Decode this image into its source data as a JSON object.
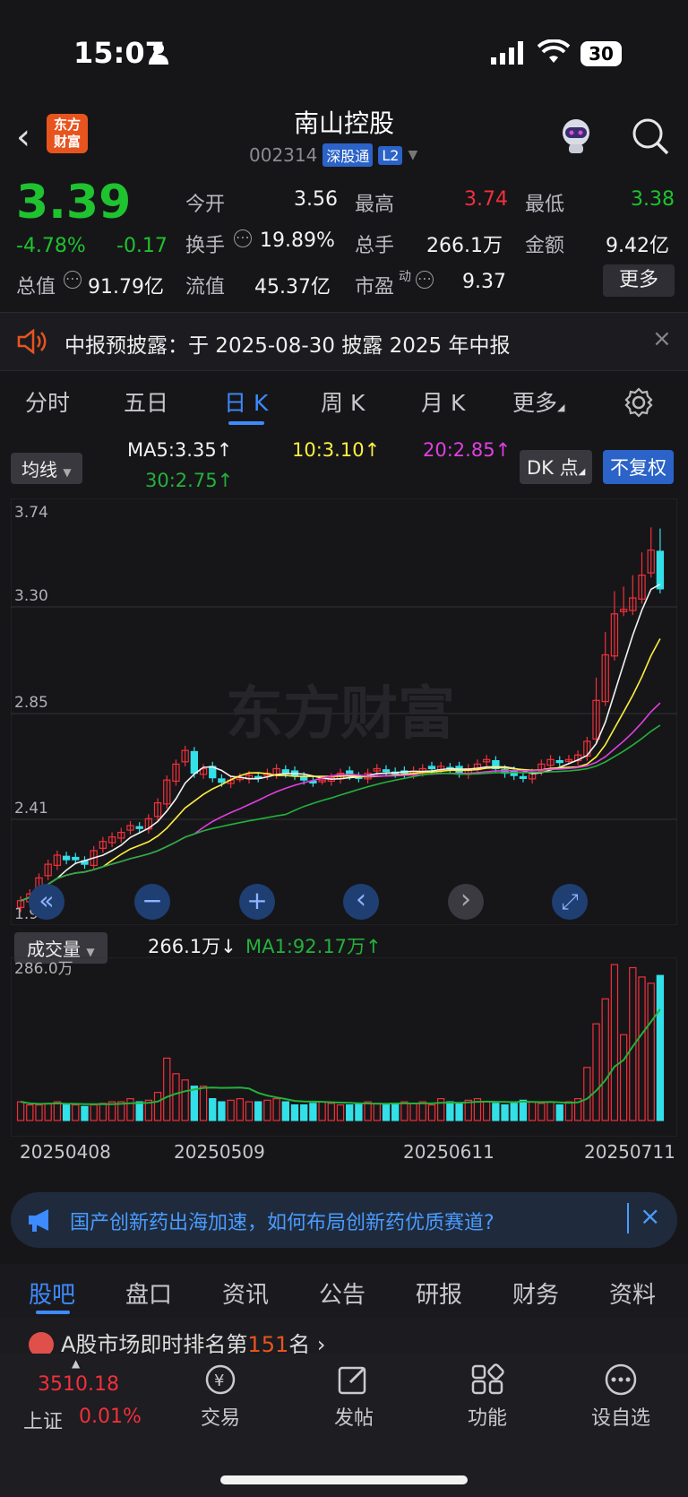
{
  "status": {
    "time": "15:07",
    "battery": "30"
  },
  "header": {
    "logo_line1": "东方",
    "logo_line2": "财富",
    "name": "南山控股",
    "code": "002314",
    "badge1": "深股通",
    "badge2": "L2"
  },
  "quote": {
    "price": "3.39",
    "change_pct": "-4.78%",
    "change": "-0.17",
    "open_label": "今开",
    "open": "3.56",
    "high_label": "最高",
    "high": "3.74",
    "low_label": "最低",
    "low": "3.38",
    "turnover_label": "换手",
    "turnover": "19.89%",
    "volume_label": "总手",
    "volume": "266.1万",
    "amount_label": "金额",
    "amount": "9.42亿",
    "mcap_label": "总值",
    "mcap": "91.79亿",
    "float_label": "流值",
    "float": "45.37亿",
    "pe_label": "市盈",
    "pe_sup": "动",
    "pe": "9.37",
    "more": "更多"
  },
  "notice": {
    "text": "中报预披露：于 2025-08-30 披露 2025 年中报"
  },
  "tabs": [
    "分时",
    "五日",
    "日 K",
    "周 K",
    "月 K",
    "更多"
  ],
  "ma": {
    "selector": "均线",
    "ma5": "MA5:3.35",
    "ma10": "10:3.10",
    "ma20": "20:2.85",
    "ma30": "30:2.75",
    "dk": "DK 点",
    "fq": "不复权"
  },
  "kchart": {
    "watermark": "东方财富",
    "y_labels": [
      "3.74",
      "3.30",
      "2.85",
      "2.41",
      "1.96"
    ]
  },
  "volume": {
    "selector": "成交量",
    "value": "266.1万",
    "ma1": "MA1:92.17万",
    "max_label": "286.0万"
  },
  "chart_data": {
    "type": "candlestick",
    "y_range": [
      1.96,
      3.74
    ],
    "x_labels": [
      "20250408",
      "20250509",
      "20250611",
      "20250711"
    ],
    "volume_max": "286.0万",
    "close": [
      2.02,
      2.05,
      2.12,
      2.18,
      2.22,
      2.2,
      2.2,
      2.18,
      2.24,
      2.28,
      2.3,
      2.32,
      2.35,
      2.34,
      2.38,
      2.45,
      2.55,
      2.62,
      2.68,
      2.58,
      2.6,
      2.56,
      2.54,
      2.55,
      2.56,
      2.57,
      2.56,
      2.58,
      2.6,
      2.58,
      2.57,
      2.55,
      2.54,
      2.55,
      2.56,
      2.58,
      2.57,
      2.56,
      2.58,
      2.6,
      2.59,
      2.58,
      2.58,
      2.59,
      2.6,
      2.6,
      2.61,
      2.6,
      2.58,
      2.6,
      2.62,
      2.64,
      2.6,
      2.58,
      2.57,
      2.56,
      2.58,
      2.62,
      2.64,
      2.63,
      2.64,
      2.66,
      2.72,
      2.9,
      3.1,
      3.28,
      3.3,
      3.35,
      3.45,
      3.56,
      3.39
    ],
    "volume_rel": [
      0.12,
      0.1,
      0.1,
      0.11,
      0.12,
      0.1,
      0.1,
      0.09,
      0.1,
      0.11,
      0.12,
      0.12,
      0.14,
      0.12,
      0.13,
      0.18,
      0.4,
      0.3,
      0.26,
      0.22,
      0.22,
      0.14,
      0.12,
      0.13,
      0.14,
      0.12,
      0.12,
      0.13,
      0.14,
      0.12,
      0.1,
      0.1,
      0.11,
      0.12,
      0.11,
      0.1,
      0.1,
      0.11,
      0.12,
      0.11,
      0.1,
      0.11,
      0.12,
      0.11,
      0.12,
      0.1,
      0.14,
      0.12,
      0.11,
      0.13,
      0.14,
      0.12,
      0.11,
      0.1,
      0.11,
      0.13,
      0.12,
      0.11,
      0.12,
      0.1,
      0.12,
      0.14,
      0.34,
      0.62,
      0.78,
      1.0,
      0.55,
      0.98,
      0.92,
      0.88,
      0.93
    ]
  },
  "nav": {
    "left": "«",
    "minus": "−",
    "plus": "+",
    "prev": "‹",
    "next": "›",
    "expand": "⤢"
  },
  "banner": {
    "text": "国产创新药出海加速，如何布局创新药优质赛道?"
  },
  "bottom_tabs": [
    "股吧",
    "盘口",
    "资讯",
    "公告",
    "研报",
    "财务",
    "资料"
  ],
  "ranking": {
    "prefix": "A股市场即时排名第",
    "rank": "151",
    "suffix": "名"
  },
  "bottombar": {
    "index_value": "3510.18",
    "index_name": "上证",
    "index_change": "0.01%",
    "trade": "交易",
    "post": "发帖",
    "func": "功能",
    "watch": "设自选"
  }
}
